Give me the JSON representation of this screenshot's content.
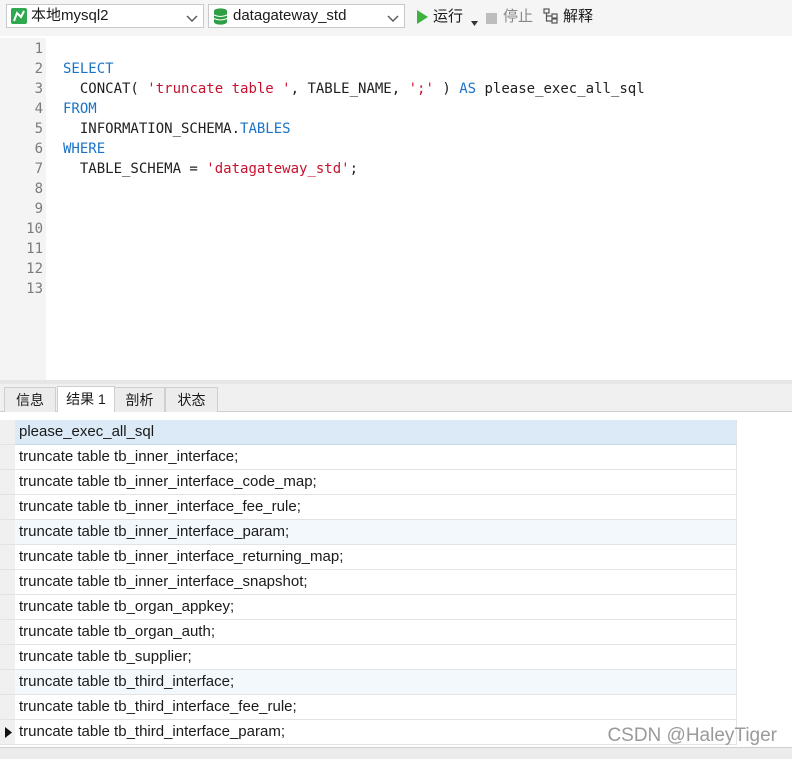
{
  "toolbar": {
    "connection": "本地mysql2",
    "database": "datagateway_std",
    "run_label": "运行",
    "stop_label": "停止",
    "explain_label": "解释",
    "colors": {
      "run": "#3cb43c",
      "db": "#2f9e44",
      "conn": "#2fa84f"
    }
  },
  "editor": {
    "line_numbers": [
      "1",
      "2",
      "3",
      "4",
      "5",
      "6",
      "7",
      "8",
      "9",
      "10",
      "11",
      "12",
      "13"
    ],
    "lines": [
      [],
      [
        {
          "t": "SELECT",
          "c": "kw"
        }
      ],
      [
        {
          "t": "  CONCAT( ",
          "c": ""
        },
        {
          "t": "'truncate table '",
          "c": "str"
        },
        {
          "t": ", TABLE_NAME, ",
          "c": ""
        },
        {
          "t": "';'",
          "c": "str"
        },
        {
          "t": " ) ",
          "c": ""
        },
        {
          "t": "AS",
          "c": "kw"
        },
        {
          "t": " please_exec_all_sql",
          "c": ""
        }
      ],
      [
        {
          "t": "FROM",
          "c": "kw"
        }
      ],
      [
        {
          "t": "  INFORMATION_SCHEMA.",
          "c": ""
        },
        {
          "t": "TABLES",
          "c": "kw"
        }
      ],
      [
        {
          "t": "WHERE",
          "c": "kw"
        }
      ],
      [
        {
          "t": "  TABLE_SCHEMA = ",
          "c": ""
        },
        {
          "t": "'datagateway_std'",
          "c": "str"
        },
        {
          "t": ";",
          "c": ""
        }
      ],
      [],
      [],
      [],
      [],
      [],
      []
    ]
  },
  "tabs": [
    {
      "label": "信息",
      "active": false
    },
    {
      "label": "结果 1",
      "active": true
    },
    {
      "label": "剖析",
      "active": false
    },
    {
      "label": "状态",
      "active": false
    }
  ],
  "results": {
    "column": "please_exec_all_sql",
    "rows": [
      "truncate table tb_inner_interface;",
      "truncate table tb_inner_interface_code_map;",
      "truncate table tb_inner_interface_fee_rule;",
      "truncate table tb_inner_interface_param;",
      "truncate table tb_inner_interface_returning_map;",
      "truncate table tb_inner_interface_snapshot;",
      "truncate table tb_organ_appkey;",
      "truncate table tb_organ_auth;",
      "truncate table tb_supplier;",
      "truncate table tb_third_interface;",
      "truncate table tb_third_interface_fee_rule;",
      "truncate table tb_third_interface_param;"
    ],
    "current_row_index": 11,
    "alt_rows": [
      3,
      9
    ]
  },
  "watermark": "CSDN @HaleyTiger"
}
